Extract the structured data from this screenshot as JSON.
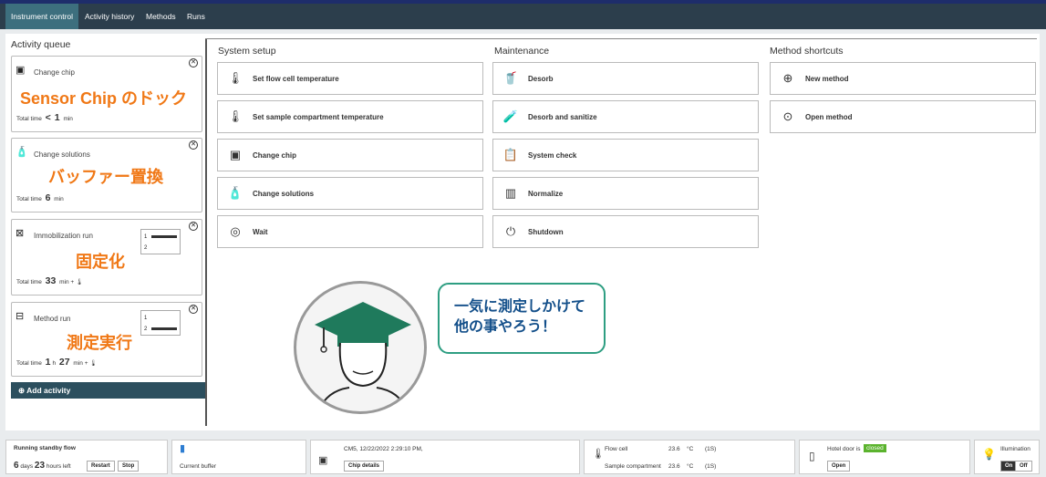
{
  "nav": {
    "tabs": [
      "Instrument control",
      "Activity history",
      "Methods",
      "Runs"
    ]
  },
  "queue": {
    "title": "Activity queue",
    "add": "Add activity",
    "cards": [
      {
        "name": "Change chip",
        "jp": "Sensor Chip のドック",
        "total": "Total time",
        "pre": "<",
        "val": "1",
        "unit": "min"
      },
      {
        "name": "Change solutions",
        "jp": "バッファー置換",
        "total": "Total time",
        "val": "6",
        "unit": "min"
      },
      {
        "name": "Immobilization run",
        "jp": "固定化",
        "total": "Total time",
        "val": "33",
        "unit": "min +"
      },
      {
        "name": "Method run",
        "jp": "測定実行",
        "total": "Total time",
        "h": "1",
        "hu": "h",
        "val": "27",
        "unit": "min +"
      }
    ],
    "mini_rows": [
      "1",
      "2"
    ]
  },
  "sections": {
    "setup": {
      "title": "System setup",
      "items": [
        "Set flow cell temperature",
        "Set sample compartment temperature",
        "Change chip",
        "Change solutions",
        "Wait"
      ]
    },
    "maint": {
      "title": "Maintenance",
      "items": [
        "Desorb",
        "Desorb and sanitize",
        "System check",
        "Normalize",
        "Shutdown"
      ]
    },
    "short": {
      "title": "Method shortcuts",
      "items": [
        "New method",
        "Open method"
      ]
    }
  },
  "bubble": {
    "line1": "一気に測定しかけて",
    "line2": "他の事やろう！"
  },
  "status": {
    "standby": "Running standby flow",
    "days": "6",
    "days_u": "days",
    "hours": "23",
    "hours_u": "hours",
    "left": "left",
    "restart": "Restart",
    "stop": "Stop",
    "buffer": "Current buffer",
    "chip": "CM5, 12/22/2022 2:29:10 PM,",
    "chip_btn": "Chip details",
    "fc": "Flow cell",
    "fc_v": "23.6",
    "sc": "Sample compartment",
    "sc_v": "23.6",
    "deg": "°C",
    "qs": "(1S)",
    "door": "Hotel door is",
    "closed": "closed",
    "open": "Open",
    "illum": "Illumination",
    "on": "On",
    "off": "Off"
  }
}
